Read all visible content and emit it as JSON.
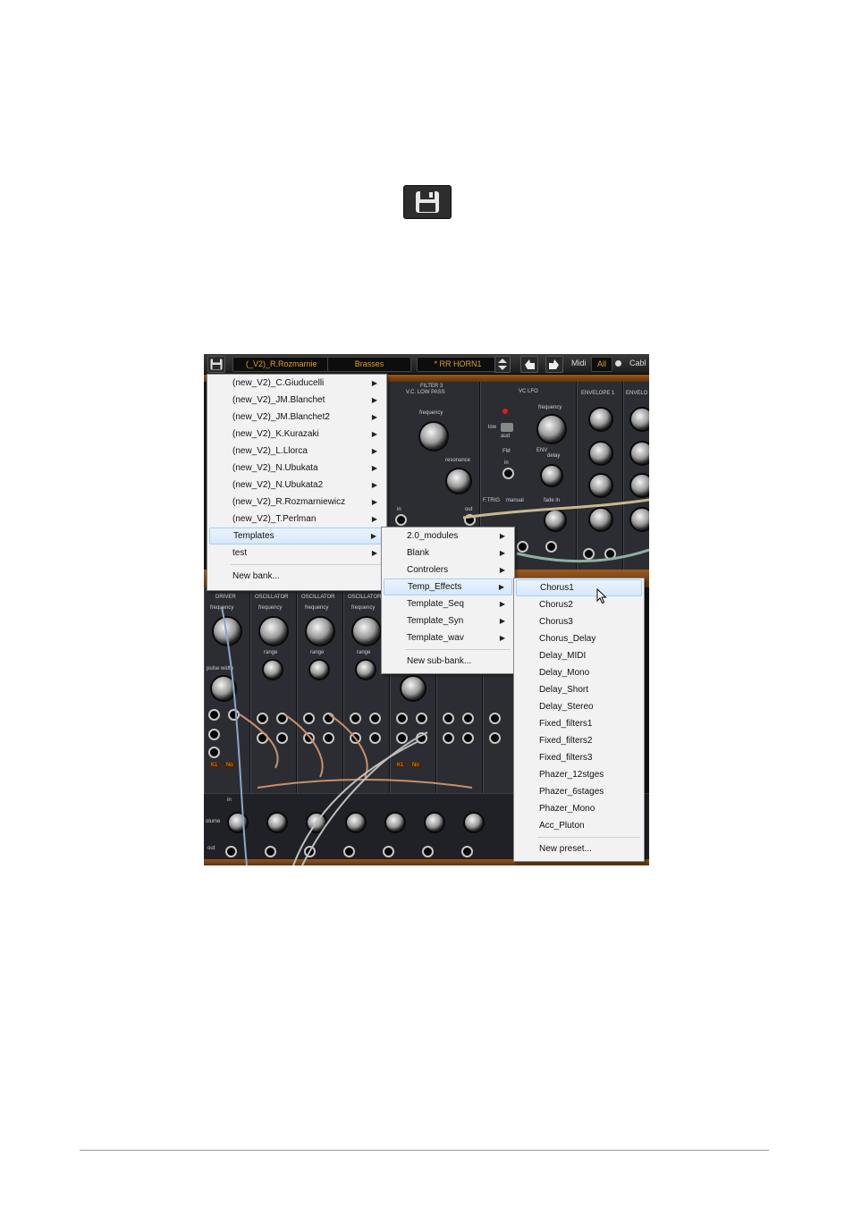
{
  "toolbar": {
    "bank": "(_V2)_R.Rozmarnie",
    "category": "Brasses",
    "preset": "* RR HORN1",
    "midi_label": "Midi",
    "midi_channel": "All",
    "cable_label": "Cabl"
  },
  "modules": {
    "filter_title": "FILTER 3",
    "filter_subtitle": "V.C. LOW PASS",
    "filter_frequency": "frequency",
    "filter_resonance": "resonance",
    "filter_in": "in",
    "filter_out": "out",
    "lfo_title": "VC LFO",
    "lfo_frequency": "frequency",
    "lfo_low": "low",
    "lfo_audio": "aud",
    "lfo_fm": "FM",
    "lfo_in": "in",
    "lfo_env": "ENV",
    "lfo_delay": "delay",
    "lfo_fade": "fade in",
    "lfo_manual": "manual",
    "lfo_ftrig": "F.TRIG",
    "env1_title": "ENVELOPE 1",
    "env2_title": "ENVELO",
    "driver_title": "DRIVER",
    "osc1_title": "OSCILLATOR",
    "osc2_title": "OSCILLATOR",
    "osc3_title": "OSCILLATOR",
    "osc_frequency": "frequency",
    "osc_range": "range",
    "pulse_width": "pulse width",
    "k1": "K1",
    "no": "No",
    "volume": "olume",
    "out": "out",
    "in": "in"
  },
  "menu_banks": {
    "items": [
      "(new_V2)_C.Giuducelli",
      "(new_V2)_JM.Blanchet",
      "(new_V2)_JM.Blanchet2",
      "(new_V2)_K.Kurazaki",
      "(new_V2)_L.Llorca",
      "(new_V2)_N.Ubukata",
      "(new_V2)_N.Ubukata2",
      "(new_V2)_R.Rozmarniewicz",
      "(new_V2)_T.Perlman",
      "Templates",
      "test"
    ],
    "new_bank": "New bank..."
  },
  "menu_subbanks": {
    "items": [
      "2.0_modules",
      "Blank",
      "Controlers",
      "Temp_Effects",
      "Template_Seq",
      "Template_Syn",
      "Template_wav"
    ],
    "new_sub_bank": "New sub-bank..."
  },
  "menu_presets": {
    "items": [
      "Chorus1",
      "Chorus2",
      "Chorus3",
      "Chorus_Delay",
      "Delay_MIDI",
      "Delay_Mono",
      "Delay_Short",
      "Delay_Stereo",
      "Fixed_filters1",
      "Fixed_filters2",
      "Fixed_filters3",
      "Phazer_12stges",
      "Phazer_6stages",
      "Phazer_Mono",
      "Acc_Pluton"
    ],
    "new_preset": "New preset..."
  },
  "icons": {
    "save": "save-icon",
    "submenu": "chevron-right-icon",
    "cursor": "mouse-pointer-icon"
  },
  "colors": {
    "highlight": "#d6e8fb",
    "toolbar_text": "#e0a020",
    "panel": "#2b2d33"
  }
}
